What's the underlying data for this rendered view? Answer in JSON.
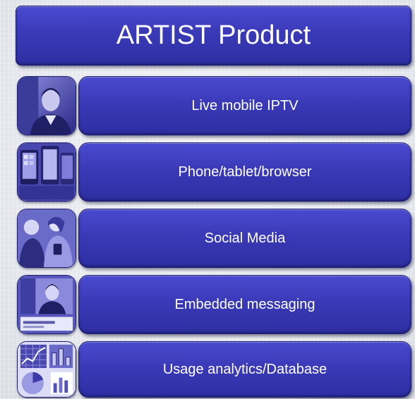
{
  "title": "ARTIST Product",
  "items": [
    {
      "label": "Live mobile IPTV",
      "thumbnail": "news-anchor-icon"
    },
    {
      "label": "Phone/tablet/browser",
      "thumbnail": "devices-icon"
    },
    {
      "label": "Social Media",
      "thumbnail": "people-icon"
    },
    {
      "label": "Embedded messaging",
      "thumbnail": "broadcast-screen-icon"
    },
    {
      "label": "Usage analytics/Database",
      "thumbnail": "analytics-charts-icon"
    }
  ],
  "colors": {
    "panel": "#3a3ab8",
    "panel_border": "#1d1d6e",
    "text": "#ffffff",
    "background": "#eceef2"
  }
}
